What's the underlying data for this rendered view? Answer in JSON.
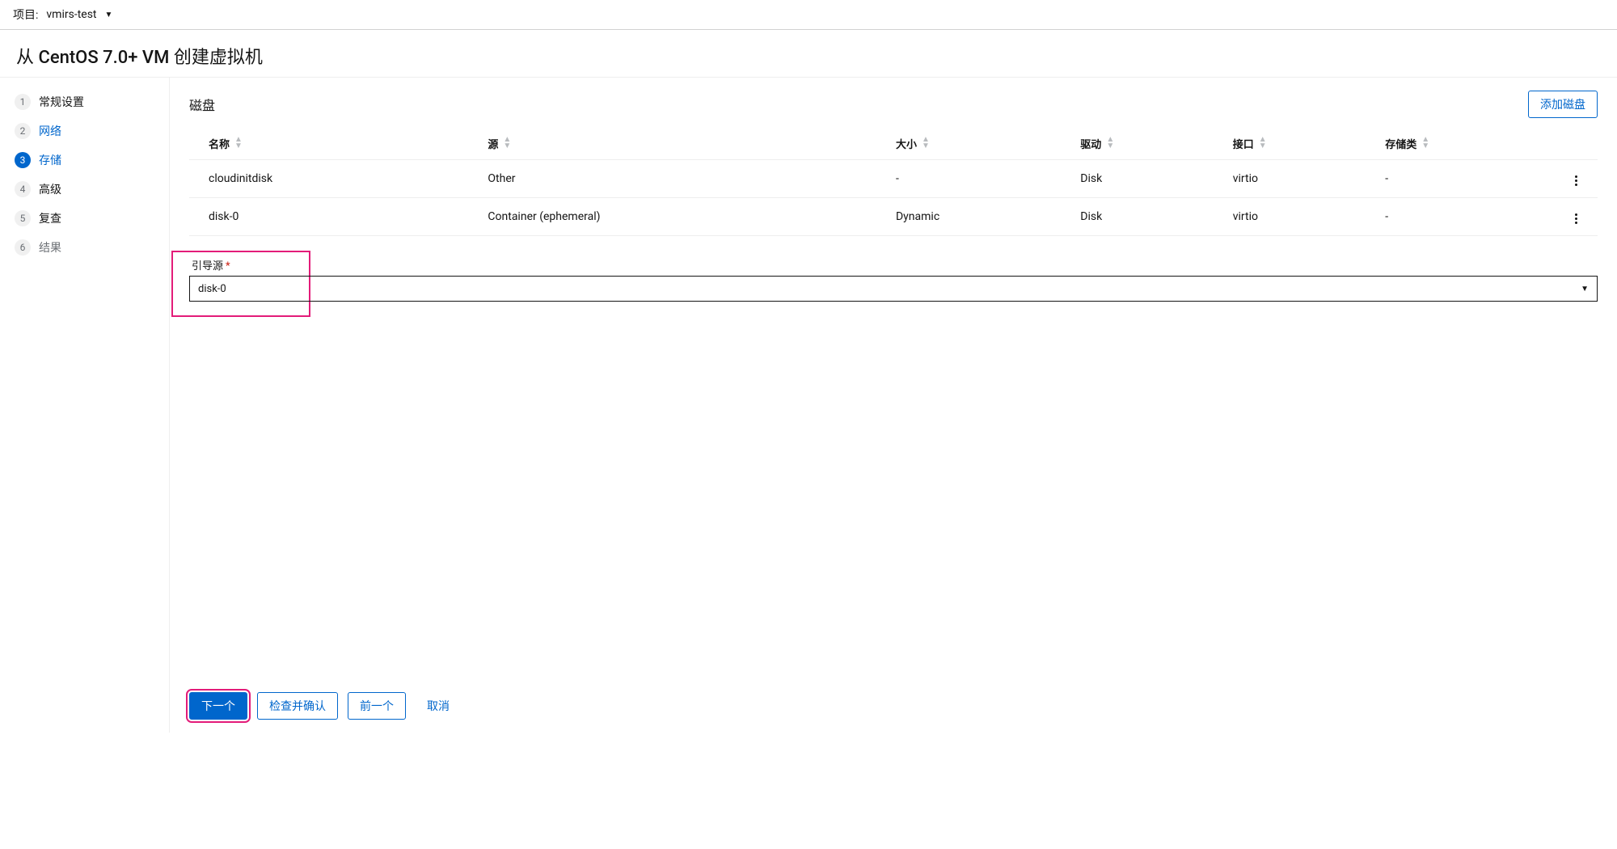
{
  "topbar": {
    "project_prefix": "项目:",
    "project_name": "vmirs-test"
  },
  "page_title": "从 CentOS 7.0+ VM 创建虚拟机",
  "sidebar": {
    "steps": [
      {
        "num": "1",
        "label": "常规设置",
        "state": "default"
      },
      {
        "num": "2",
        "label": "网络",
        "state": "link"
      },
      {
        "num": "3",
        "label": "存储",
        "state": "active"
      },
      {
        "num": "4",
        "label": "高级",
        "state": "default"
      },
      {
        "num": "5",
        "label": "复查",
        "state": "default"
      },
      {
        "num": "6",
        "label": "结果",
        "state": "muted"
      }
    ]
  },
  "main": {
    "section_title": "磁盘",
    "add_disk_label": "添加磁盘",
    "table": {
      "headers": {
        "name": "名称",
        "source": "源",
        "size": "大小",
        "drive": "驱动",
        "interface": "接口",
        "storage_class": "存储类"
      },
      "rows": [
        {
          "name": "cloudinitdisk",
          "source": "Other",
          "size": "-",
          "drive": "Disk",
          "interface": "virtio",
          "storage_class": "-"
        },
        {
          "name": "disk-0",
          "source": "Container (ephemeral)",
          "size": "Dynamic",
          "drive": "Disk",
          "interface": "virtio",
          "storage_class": "-"
        }
      ]
    },
    "boot_source": {
      "label": "引导源",
      "value": "disk-0"
    }
  },
  "footer": {
    "next": "下一个",
    "review_confirm": "检查并确认",
    "previous": "前一个",
    "cancel": "取消"
  }
}
